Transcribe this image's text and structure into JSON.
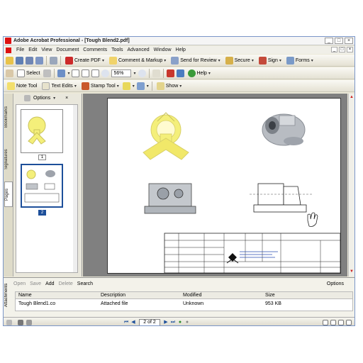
{
  "window": {
    "title": "Adobe Acrobat Professional - [Tough Blend2.pdf]"
  },
  "menu": [
    "File",
    "Edit",
    "View",
    "Document",
    "Comments",
    "Tools",
    "Advanced",
    "Window",
    "Help"
  ],
  "toolbar1": {
    "create_pdf": "Create PDF",
    "comment_markup": "Comment & Markup",
    "send_for_review": "Send for Review",
    "secure": "Secure",
    "sign": "Sign",
    "forms": "Forms"
  },
  "toolbar2": {
    "select": "Select",
    "zoom": "56%",
    "help": "Help"
  },
  "toolbar3": {
    "note_tool": "Note Tool",
    "text_edits": "Text Edits",
    "stamp_tool": "Stamp Tool",
    "show": "Show"
  },
  "nav_tabs": [
    "Bookmarks",
    "Signatures",
    "Pages"
  ],
  "pages_panel": {
    "options": "Options",
    "pages": [
      "1",
      "2"
    ]
  },
  "attachments": {
    "tab": "Attachments",
    "toolbar": {
      "open": "Open",
      "save": "Save",
      "add": "Add",
      "delete": "Delete",
      "search": "Search",
      "options": "Options"
    },
    "columns": [
      "Name",
      "Description",
      "Modified",
      "Size"
    ],
    "rows": [
      {
        "name": "Tough Blend1.co",
        "description": "Attached file",
        "modified": "Unknown",
        "size": "953 KB"
      }
    ]
  },
  "status": {
    "page_indicator": "2 of 2"
  },
  "colors": {
    "selection": "#1d4f9a",
    "doc_background": "#808080",
    "part_yellow": "#f4ef7a",
    "part_grey": "#b8bcc2"
  }
}
